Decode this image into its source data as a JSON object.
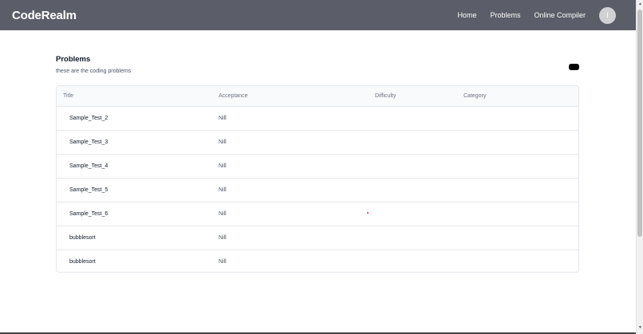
{
  "app": {
    "brand": "CodeRealm"
  },
  "nav": {
    "links": [
      "Home",
      "Problems",
      "Online Compiler"
    ],
    "avatar_initial": "I"
  },
  "page": {
    "title": "Problems",
    "subtitle": "these are the coding problems"
  },
  "table": {
    "headers": [
      "Title",
      "Acceptance",
      "Difficulty",
      "Category"
    ],
    "rows": [
      {
        "title": "Sample_Test_2",
        "acceptance": "Nill",
        "difficulty": "",
        "category": ""
      },
      {
        "title": "Sample_Test_3",
        "acceptance": "Nill",
        "difficulty": "",
        "category": ""
      },
      {
        "title": "Sample_Test_4",
        "acceptance": "Nill",
        "difficulty": "",
        "category": ""
      },
      {
        "title": "Sample_Test_5",
        "acceptance": "Nill",
        "difficulty": "",
        "category": ""
      },
      {
        "title": "Sample_Test_6",
        "acceptance": "Nill",
        "difficulty": "",
        "category": ""
      },
      {
        "title": "bubblesort",
        "acceptance": "Nill",
        "difficulty": "",
        "category": ""
      },
      {
        "title": "bubblesort",
        "acceptance": "Nill",
        "difficulty": "",
        "category": ""
      }
    ]
  },
  "colors": {
    "navbar": "#5b5e68",
    "accent_button": "#000000"
  }
}
